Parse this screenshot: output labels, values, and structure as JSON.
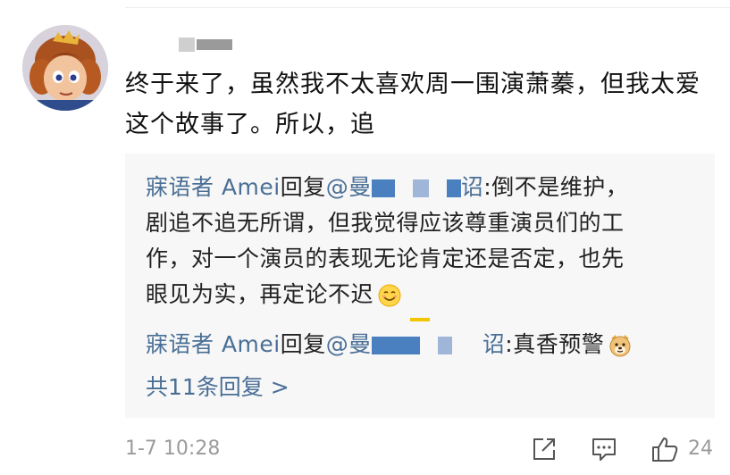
{
  "comment": {
    "text": "终于来了，虽然我不太喜欢周一围演萧蓁，但我太爱这个故事了。所以，追",
    "timestamp": "1-7 10:28",
    "like_count": "24"
  },
  "replies": [
    {
      "author": "寐语者 Amei",
      "reply_word": "回复",
      "mention_start": "@曼",
      "mention_end": "诏",
      "text_first": ":倒不是维护，",
      "text_lines": [
        "剧追不追无所谓，但我觉得应该尊重演员们的工",
        "作，对一个演员的表现无论肯定还是否定，也先",
        "眼见为实，再定论不迟"
      ],
      "emoji": "smiling-face-icon"
    },
    {
      "author": "寐语者 Amei",
      "reply_word": "回复",
      "mention_start": "@曼",
      "mention_end": "诏",
      "text_first": ":真香预警",
      "emoji": "dog-face-icon"
    }
  ],
  "more_replies": "共11条回复 >",
  "colors": {
    "link": "#4a6f96",
    "mask": "#4a80c0",
    "muted": "#9b9b9b",
    "reply_bg": "#f7f7f7"
  }
}
